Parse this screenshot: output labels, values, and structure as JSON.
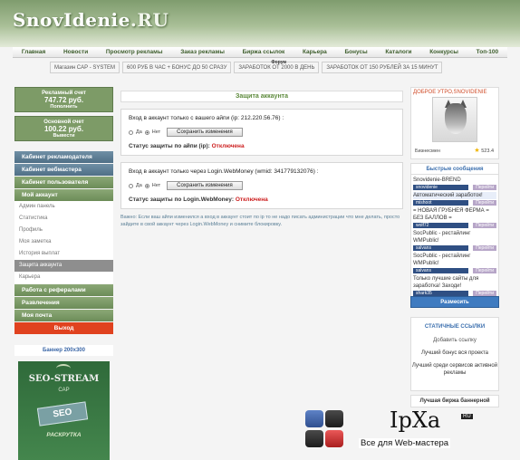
{
  "site": {
    "logo_main": "SnovIdenie",
    "logo_ru": ".RU"
  },
  "topnav": [
    "Главная",
    "Новости",
    "Просмотр рекламы",
    "Заказ рекламы",
    "Биржа ссылок",
    "Карьера",
    "Бонусы",
    "Каталоги",
    "Конкурсы",
    "Топ-100"
  ],
  "promo": {
    "items": [
      "Магазин CAP - SYSTEM",
      "600 РУБ В ЧАС + БОНУС ДО 50 СРАЗУ",
      "ЗАРАБОТОК ОТ 2000 В ДЕНЬ",
      "ЗАРАБОТОК ОТ 150 РУБЛЕЙ ЗА 15 МИНУТ"
    ],
    "tiny_label": "Форум"
  },
  "left": {
    "ad_account": {
      "label": "Рекламный счет",
      "value": "747.72 руб.",
      "action": "Пополнить"
    },
    "main_account": {
      "label": "Основной счет",
      "value": "100.22 руб.",
      "action": "Вывести"
    },
    "menus": [
      {
        "label": "Кабинет рекламодателя",
        "style": "blue"
      },
      {
        "label": "Кабинет вебмастера",
        "style": "blue"
      },
      {
        "label": "Кабинет пользователя",
        "style": "green"
      },
      {
        "label": "Мой аккаунт",
        "style": "green"
      }
    ],
    "submenu": [
      "Админ панель",
      "Статистика",
      "Профиль",
      "Моя заметка",
      "История выплат",
      "Защита аккаунта",
      "Карьера"
    ],
    "submenu_active": "Защита аккаунта",
    "more_menus": [
      "Работа с рефералами",
      "Развлечения",
      "Моя почта"
    ],
    "exit": "Выход",
    "banner_title": "Баннер 200x300",
    "banner": {
      "line1": "SEO-STREAM",
      "line2": "CAP",
      "tile": "SEO",
      "line3": "РАСКРУТКА"
    }
  },
  "center": {
    "title": "Защита аккаунта",
    "panel_ip": {
      "question": "Вход в аккаунт только с вашего айпи (ip: 212.220.56.76) :",
      "yes": "Да",
      "no": "Нет",
      "save": "Сохранить изменения",
      "status_label": "Статус защиты по айпи (ip):",
      "status_value": "Отключена"
    },
    "panel_wm": {
      "question": "Вход в аккаунт только через Login.WebMoney (wmid: 341779132076) :",
      "yes": "Да",
      "no": "Нет",
      "save": "Сохранить изменения",
      "status_label": "Статус защиты по Login.WebMoney:",
      "status_value": "Отключена"
    },
    "note": "Важно: Если ваш айпи изменился а вход в аккаунт стоит по ip то не надо писать администрации что мне делать, просто зайдите в свой аккаунт через Login.WebMoney и снимите блокировку."
  },
  "right": {
    "greeting": "ДОБРОЕ УТРО,SNOVIDENIE",
    "role": "Бизнесмен",
    "rating": "523.4",
    "messages_title": "Быстрые сообщения",
    "messages": [
      {
        "text": "Snovidenie-BREND",
        "user": "snovidenie",
        "go": "Перейти",
        "highlight": false
      },
      {
        "text": "Автоматический заработок!",
        "user": "mishoot",
        "go": "Перейти",
        "highlight": true
      },
      {
        "text": "= НОВАЯ ГРУБНЕЯ ФЕРМА = БЕЗ БАЛЛОВ =",
        "user": "wolf72",
        "go": "Перейти",
        "highlight": false
      },
      {
        "text": "SocPublic - рестайлинг WMPublic!",
        "user": "salvans",
        "go": "Перейти",
        "highlight": false
      },
      {
        "text": "SocPublic - рестайлинг WMPublic!",
        "user": "salvans",
        "go": "Перейти",
        "highlight": false
      },
      {
        "text": "Только лучшие сайты для заработка! Заходи!",
        "user": "shark35",
        "go": "Перейти",
        "highlight": false
      }
    ],
    "write_button": "Размесить",
    "static_links_title": "СТАТИЧНЫЕ ССЫЛКИ",
    "add_link": "Добавить ссылку",
    "link1": "Лучший бонус вся проекта",
    "link2": "Лучший среди сервисов активной рекламы",
    "best_banner": "Лучшая биржа баннерной"
  },
  "overlay": {
    "brand": "IpXa",
    "brand_tag": "RU",
    "tagline": "Все для Web-мастера"
  }
}
